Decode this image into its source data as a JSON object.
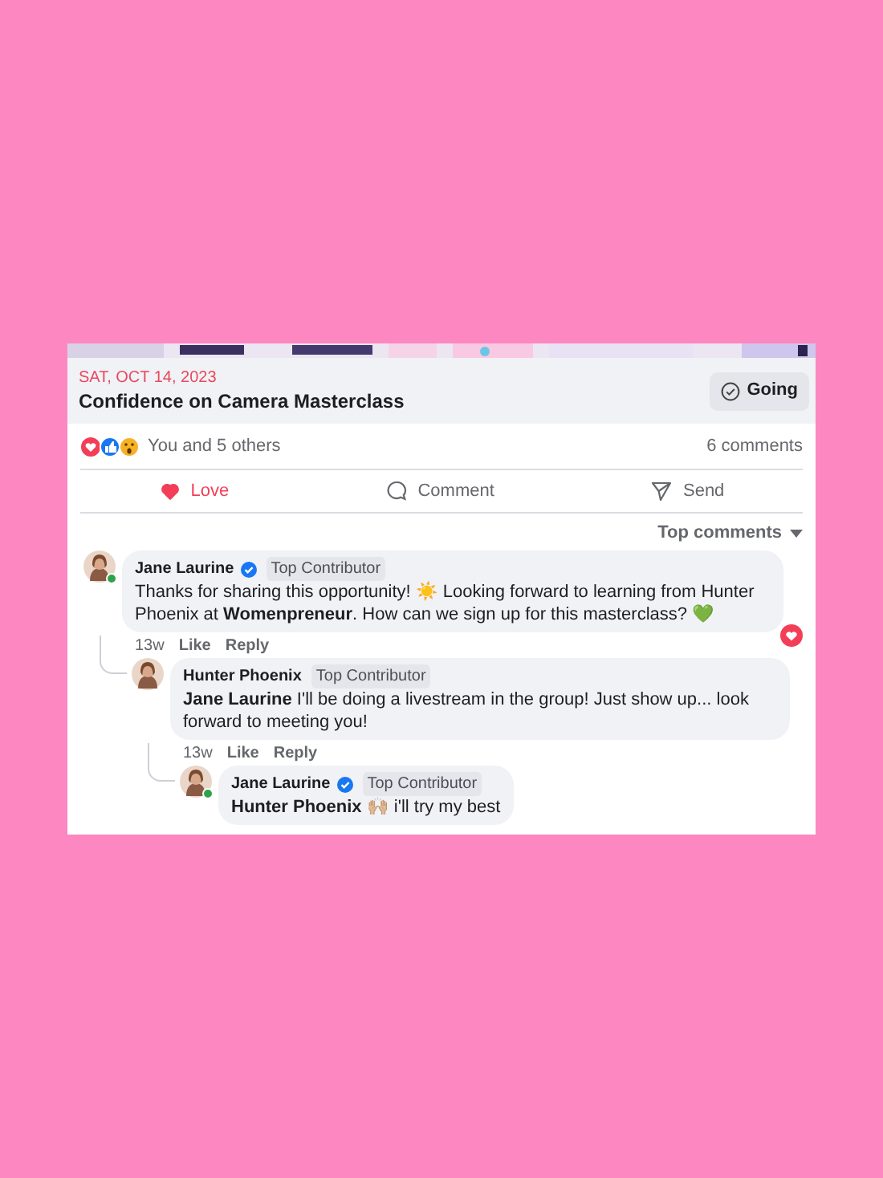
{
  "event": {
    "date": "SAT, OCT 14, 2023",
    "title": "Confidence on Camera Masterclass",
    "going_button": {
      "label": "Going"
    }
  },
  "reactions": {
    "summary": "You and 5 others",
    "comments_count": "6 comments"
  },
  "actions": [
    {
      "kind": "love",
      "label": "Love",
      "selected": true
    },
    {
      "kind": "comment",
      "label": "Comment",
      "selected": false
    },
    {
      "kind": "send",
      "label": "Send",
      "selected": false
    }
  ],
  "sort": {
    "label": "Top comments"
  },
  "comments": [
    {
      "author": "Jane Laurine",
      "verified": true,
      "online": true,
      "badge": "Top Contributor",
      "loved": true,
      "body": "Thanks for sharing this opportunity! ☀️ Looking forward to learning from Hunter Phoenix at **Womenpreneur**. How can we sign up for this masterclass? 💚",
      "time": "13w",
      "links": [
        "Like",
        "Reply"
      ],
      "children": [
        {
          "author": "Hunter Phoenix",
          "verified": false,
          "online": false,
          "badge": "Top Contributor",
          "loved": false,
          "body": "**Jane Laurine** I'll be doing a livestream in the group! Just show up... look forward to meeting you!",
          "time": "13w",
          "links": [
            "Like",
            "Reply"
          ],
          "children": [
            {
              "author": "Jane Laurine",
              "verified": true,
              "online": true,
              "badge": "Top Contributor",
              "loved": false,
              "body": "**Hunter Phoenix** 🙌🏼 i'll try my best"
            }
          ]
        }
      ]
    }
  ]
}
